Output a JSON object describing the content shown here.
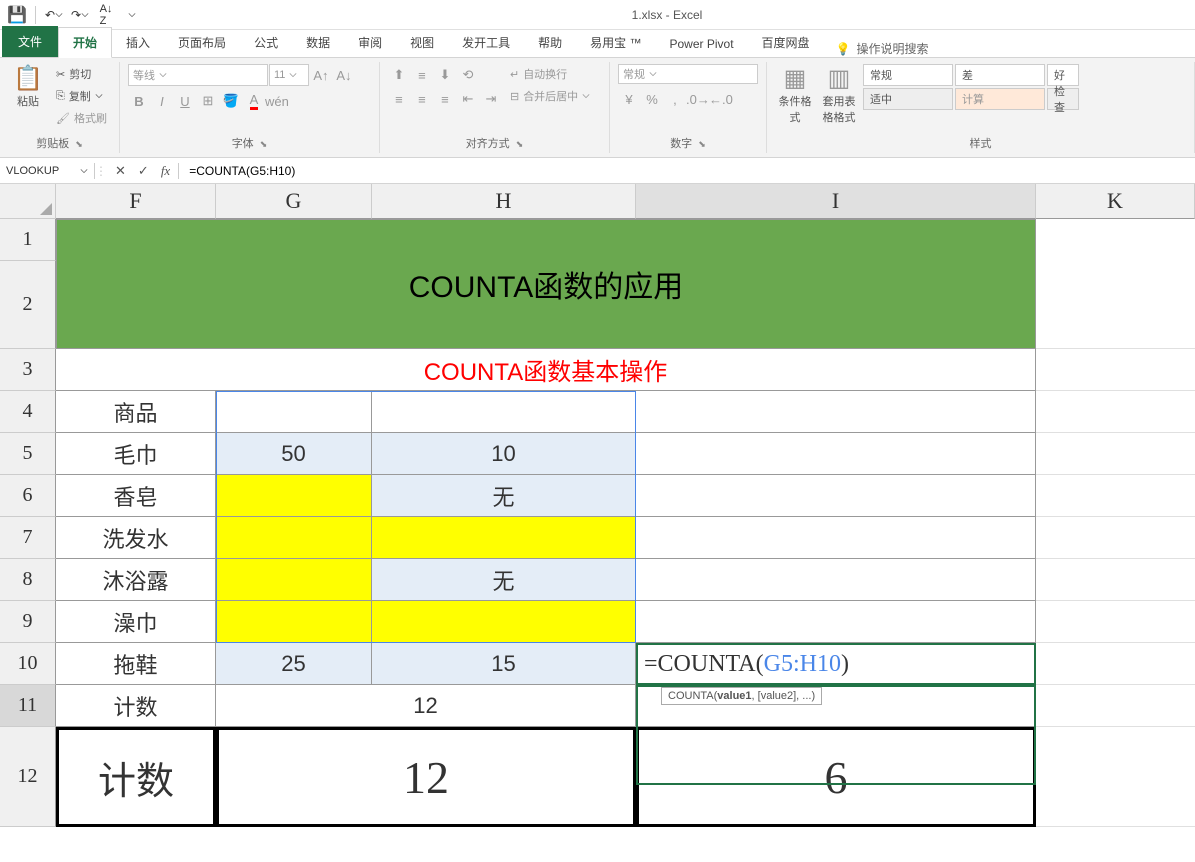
{
  "title": "1.xlsx - Excel",
  "tabs": {
    "file": "文件",
    "home": "开始",
    "insert": "插入",
    "pageLayout": "页面布局",
    "formulas": "公式",
    "data": "数据",
    "review": "审阅",
    "view": "视图",
    "developer": "发开工具",
    "help": "帮助",
    "yiyongbao": "易用宝 ™",
    "powerPivot": "Power Pivot",
    "baidu": "百度网盘",
    "tellMe": "操作说明搜索"
  },
  "ribbon": {
    "clipboard": {
      "label": "剪贴板",
      "paste": "粘贴",
      "cut": "剪切",
      "copy": "复制",
      "format": "格式刷"
    },
    "font": {
      "label": "字体",
      "name": "等线",
      "size": "11"
    },
    "align": {
      "label": "对齐方式",
      "wrap": "自动换行",
      "merge": "合并后居中"
    },
    "number": {
      "label": "数字",
      "general": "常规"
    },
    "styles": {
      "label": "样式",
      "condFormat": "条件格式",
      "tableFormat": "套用表格格式",
      "normal": "常规",
      "bad": "差",
      "good": "好",
      "moderate": "适中",
      "calc": "计算",
      "check": "检查"
    }
  },
  "nameBox": "VLOOKUP",
  "formula": "=COUNTA(G5:H10)",
  "formulaDisplay": {
    "prefix": "=COUNTA(",
    "range": "G5:H10",
    "suffix": ")"
  },
  "tooltip": {
    "fn": "COUNTA(",
    "arg1": "value1",
    "rest": ", [value2], ...)"
  },
  "cols": {
    "F": "F",
    "G": "G",
    "H": "H",
    "I": "I",
    "K": "K"
  },
  "rows": [
    "1",
    "2",
    "3",
    "4",
    "5",
    "6",
    "7",
    "8",
    "9",
    "10",
    "11",
    "12"
  ],
  "sheet": {
    "title": "COUNTA函数的应用",
    "subtitle": "COUNTA函数基本操作",
    "r4": {
      "F": "商品"
    },
    "r5": {
      "F": "毛巾",
      "G": "50",
      "H": "10"
    },
    "r6": {
      "F": "香皂",
      "H": "无"
    },
    "r7": {
      "F": "洗发水"
    },
    "r8": {
      "F": "沐浴露",
      "H": "无"
    },
    "r9": {
      "F": "澡巾"
    },
    "r10": {
      "F": "拖鞋",
      "G": "25",
      "H": "15"
    },
    "r11": {
      "F": "计数",
      "GH": "12"
    },
    "r12": {
      "F": "计数",
      "GH": "12",
      "I": "6"
    }
  }
}
